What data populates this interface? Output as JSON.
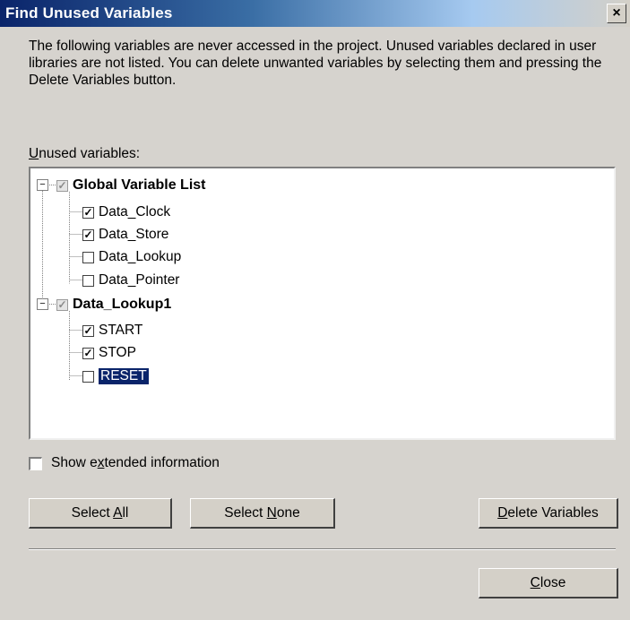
{
  "window": {
    "title": "Find Unused Variables",
    "close_glyph": "×"
  },
  "description": "The following variables are never accessed in the project. Unused variables declared in user libraries are not listed. You can delete unwanted variables by selecting them and pressing the Delete Variables button.",
  "unused_label": {
    "mnemonic": "U",
    "rest": "nused variables:"
  },
  "tree": {
    "groups": [
      {
        "label": "Global Variable List",
        "checked": true,
        "expanded": true,
        "items": [
          {
            "label": "Data_Clock",
            "checked": true
          },
          {
            "label": "Data_Store",
            "checked": true
          },
          {
            "label": "Data_Lookup",
            "checked": false
          },
          {
            "label": "Data_Pointer",
            "checked": false
          }
        ]
      },
      {
        "label": "Data_Lookup1",
        "checked": true,
        "expanded": true,
        "items": [
          {
            "label": "START",
            "checked": true
          },
          {
            "label": "STOP",
            "checked": true
          },
          {
            "label": "RESET",
            "checked": false,
            "selected": true
          }
        ]
      }
    ]
  },
  "show_extended": {
    "checked": false,
    "pre": "Show e",
    "mnemonic": "x",
    "post": "tended information"
  },
  "buttons": {
    "select_all": {
      "pre": "Select ",
      "mnemonic": "A",
      "post": "ll"
    },
    "select_none": {
      "pre": "Select ",
      "mnemonic": "N",
      "post": "one"
    },
    "delete": {
      "pre": "",
      "mnemonic": "D",
      "post": "elete Variables"
    },
    "close": {
      "pre": "",
      "mnemonic": "C",
      "post": "lose"
    }
  },
  "icons": {
    "check": "✓",
    "expander_open": "−"
  }
}
